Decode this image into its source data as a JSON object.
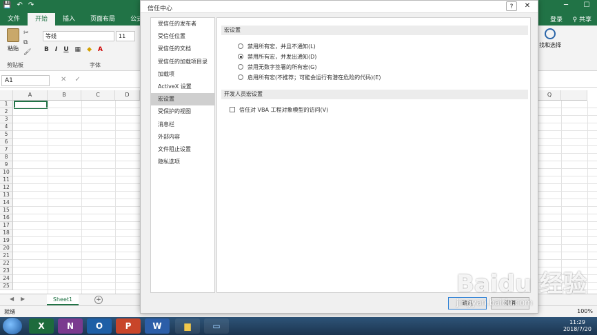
{
  "excel": {
    "tabs": [
      "文件",
      "开始",
      "插入",
      "页面布局",
      "公式"
    ],
    "active_tab": "开始",
    "signin": "登录",
    "share": "共享",
    "ribbon": {
      "paste_label": "粘贴",
      "clipboard_group": "剪贴板",
      "font_group": "字体",
      "font_name": "等线",
      "font_size": "11",
      "bold": "B",
      "italic": "I",
      "underline": "U",
      "find_label": "找和选择"
    },
    "name_box": "A1",
    "columns": [
      "A",
      "B",
      "C",
      "D",
      "Q"
    ],
    "rows": [
      "1",
      "2",
      "3",
      "4",
      "5",
      "6",
      "7",
      "8",
      "9",
      "10",
      "11",
      "12",
      "13",
      "14",
      "15",
      "16",
      "17",
      "18",
      "19",
      "20",
      "21",
      "22",
      "23",
      "24",
      "25"
    ],
    "sheet_tab": "Sheet1",
    "status": "就绪",
    "zoom": "100%"
  },
  "taskbar": {
    "time": "11:29",
    "date": "2018/7/20",
    "apps": [
      "X",
      "N",
      "O",
      "P",
      "W"
    ]
  },
  "dialog": {
    "title": "信任中心",
    "help": "?",
    "close": "✕",
    "nav_items": [
      "受信任的发布者",
      "受信任位置",
      "受信任的文档",
      "受信任的加载项目录",
      "加载项",
      "ActiveX 设置",
      "宏设置",
      "受保护的视图",
      "消息栏",
      "外部内容",
      "文件阻止设置",
      "隐私选项"
    ],
    "selected_nav": "宏设置",
    "macro_section": "宏设置",
    "radio_options": [
      {
        "label": "禁用所有宏，并且不通知(L)",
        "checked": false
      },
      {
        "label": "禁用所有宏，并发出通知(D)",
        "checked": true
      },
      {
        "label": "禁用无数字签署的所有宏(G)",
        "checked": false
      },
      {
        "label": "启用所有宏(不推荐；可能会运行有潜在危险的代码)(E)",
        "checked": false
      }
    ],
    "dev_section": "开发人员宏设置",
    "vba_checkbox": "信任对 VBA 工程对象模型的访问(V)",
    "ok": "确定",
    "cancel": "取消"
  },
  "watermark": {
    "big": "Baidu 经验",
    "small": "jingyan.baidu.com"
  }
}
